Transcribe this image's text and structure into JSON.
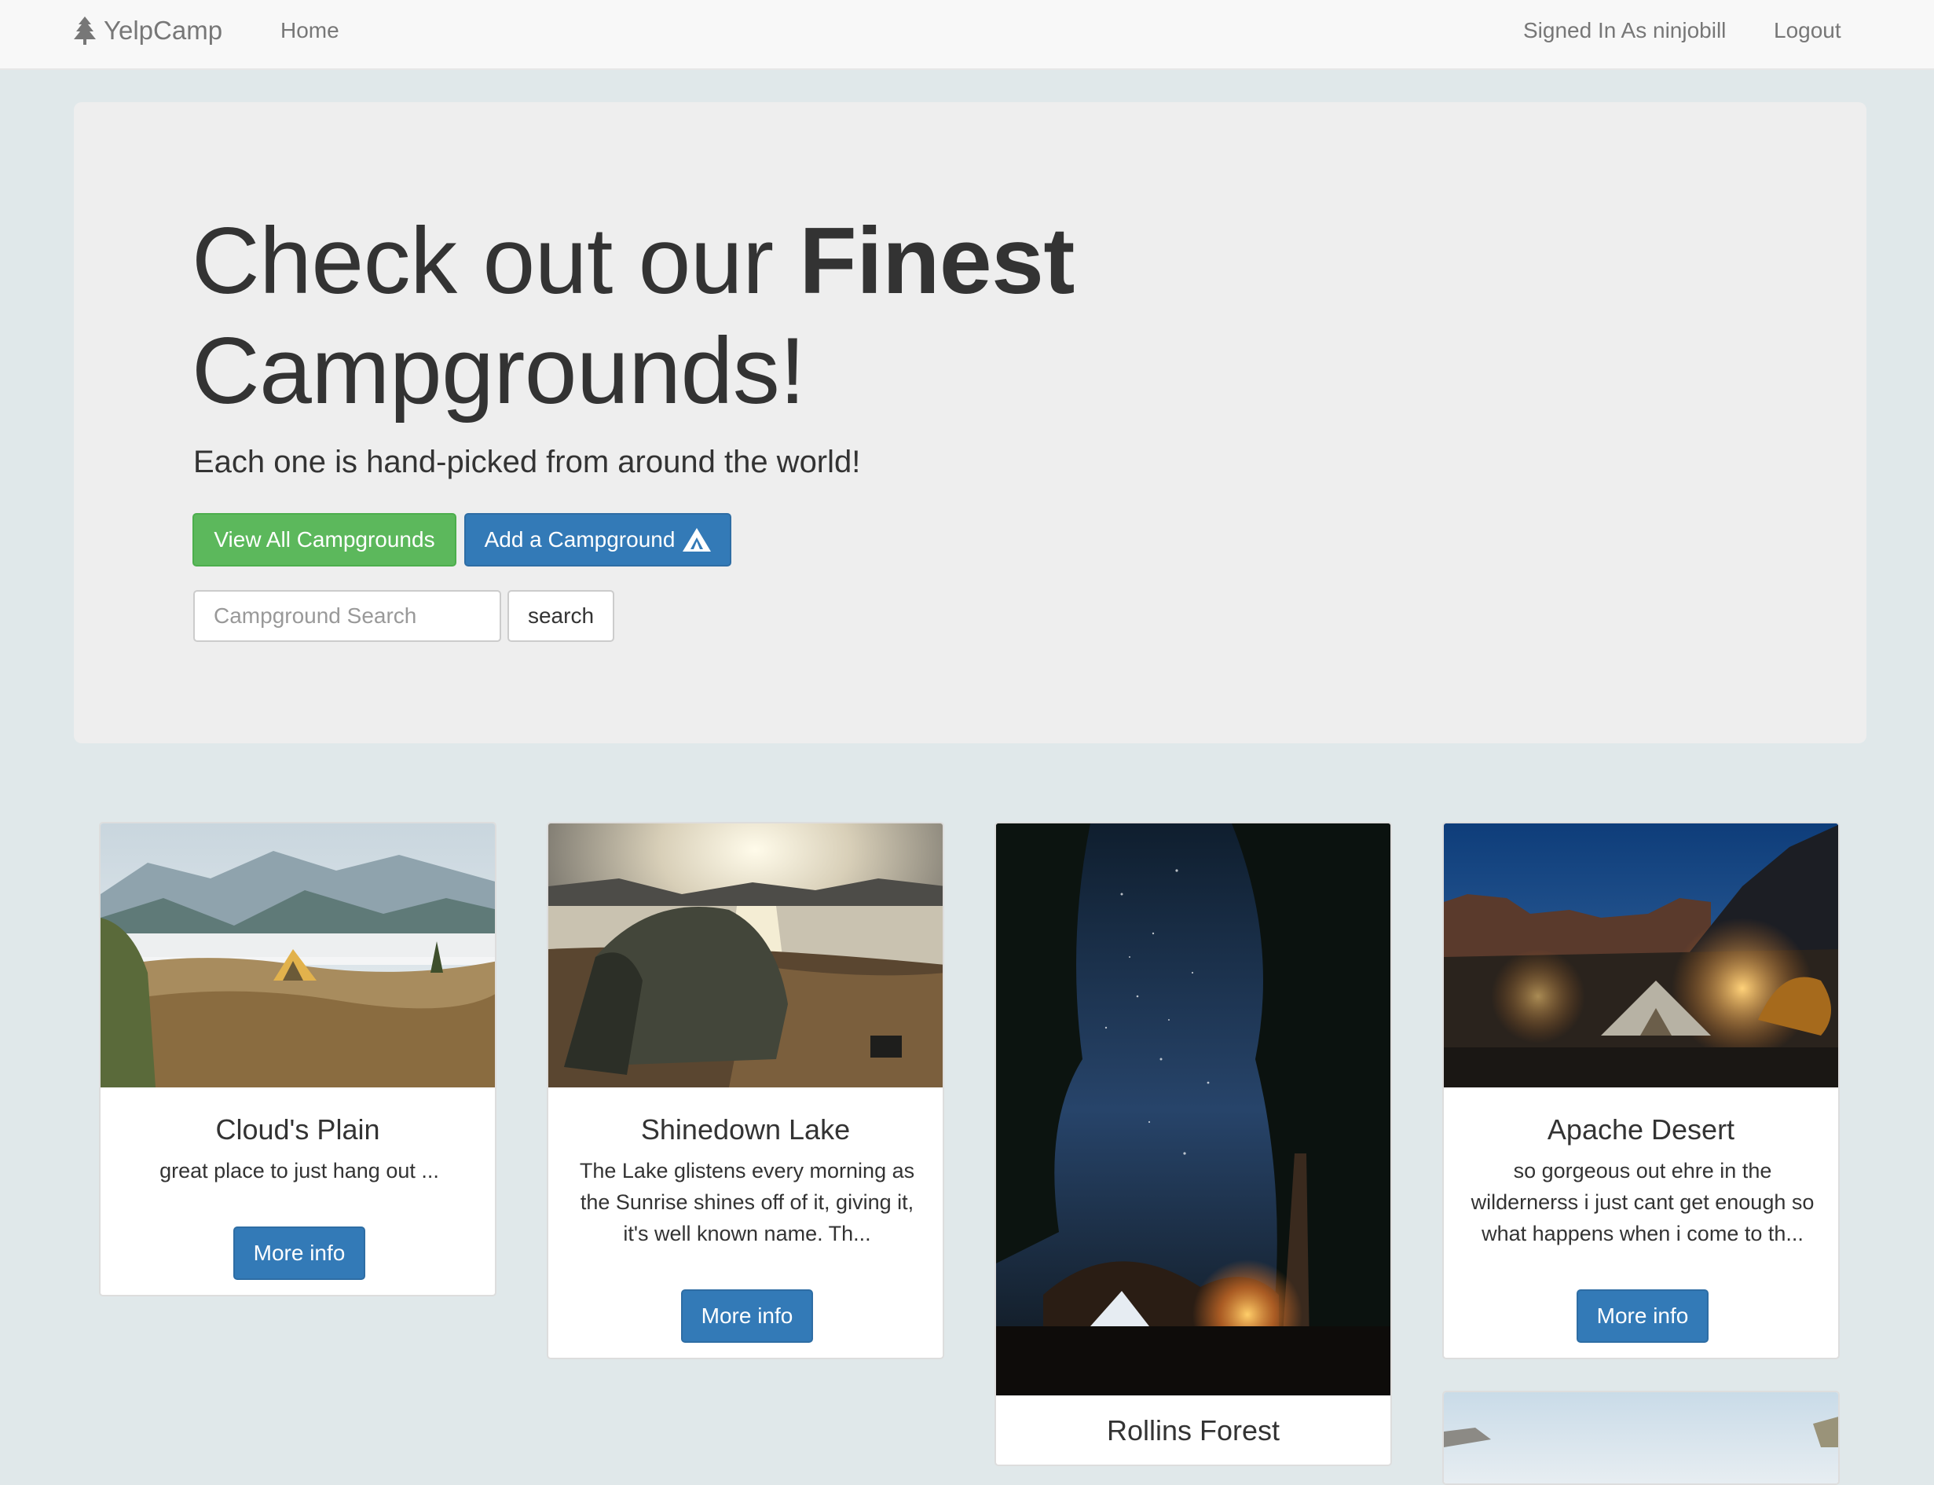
{
  "navbar": {
    "brand": "YelpCamp",
    "home": "Home",
    "signed_in": "Signed In As ninjobill",
    "logout": "Logout"
  },
  "hero": {
    "title_part1": "Check out our ",
    "title_bold": "Finest",
    "title_part2": "Campgrounds!",
    "subtitle": "Each one is hand-picked from around the world!",
    "view_all": "View All Campgrounds",
    "add_campground": "Add a Campground",
    "search_placeholder": "Campground Search",
    "search_button": "search"
  },
  "campgrounds": [
    {
      "name": "Cloud's Plain",
      "description": "great place to just hang out ...",
      "button": "More info"
    },
    {
      "name": "Shinedown Lake",
      "description": "The Lake glistens every morning as the Sunrise shines off of it, giving it, it's well known name. Th...",
      "button": "More info"
    },
    {
      "name": "Rollins Forest"
    },
    {
      "name": "Apache Desert",
      "description": "so gorgeous out ehre in the wildernerss i just cant get enough so what happens when i come to th...",
      "button": "More info"
    },
    {}
  ],
  "colors": {
    "success": "#5cb85c",
    "primary": "#337ab7",
    "page_bg": "#e0e8ea",
    "navbar_bg": "#f8f8f8"
  }
}
